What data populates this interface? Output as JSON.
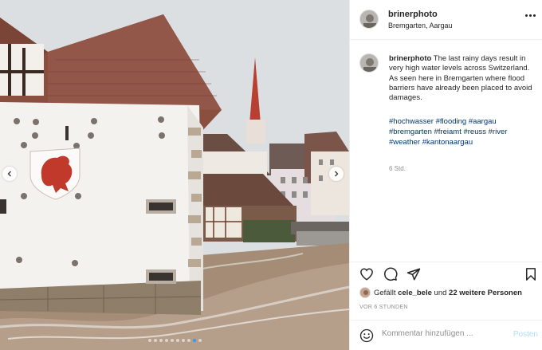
{
  "post": {
    "username": "brinerphoto",
    "location": "Bremgarten, Aargau",
    "caption": {
      "username": "brinerphoto",
      "text": "The last rainy days result in very high water levels across Switzerland. As seen here in Bremgarten where flood barriers have already been placed to avoid damages.",
      "hashtags": [
        "#hochwasser",
        "#flooding",
        "#aargau",
        "#bremgarten",
        "#freiamt",
        "#reuss",
        "#river",
        "#weather",
        "#kantonaargau"
      ],
      "time_ago": "6 Std."
    },
    "likes": {
      "prefix": "Gefällt",
      "user": "cele_bele",
      "middle": "und",
      "others": "22 weitere Personen"
    },
    "timestamp": "VOR 6 STUNDEN",
    "comment_placeholder": "Kommentar hinzufügen ...",
    "post_label": "Posten"
  },
  "carousel": {
    "count": 10,
    "active_index": 8
  },
  "icons": {
    "more": "more-options-icon",
    "like": "heart-icon",
    "comment": "comment-icon",
    "share": "paper-plane-icon",
    "save": "bookmark-icon",
    "emoji": "smiley-icon",
    "prev": "chevron-left-icon",
    "next": "chevron-right-icon"
  },
  "colors": {
    "hashtag": "#00376b",
    "muted": "#8e8e8e",
    "post_button": "#b2dffc",
    "active_dot": "#3897f0"
  }
}
